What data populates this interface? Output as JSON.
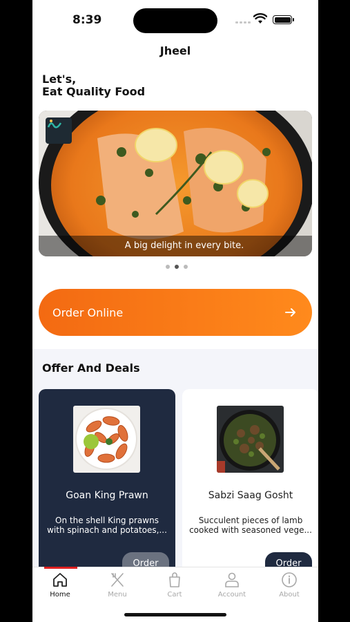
{
  "status_bar": {
    "time": "8:39"
  },
  "header": {
    "title": "Jheel"
  },
  "greeting": {
    "line1": "Let's,",
    "line2": "Eat Quality Food"
  },
  "banner": {
    "caption": "A big delight in every bite.",
    "logo_icon": "jheel-logo",
    "pages": 3,
    "active_page": 2
  },
  "order_online": {
    "label": "Order Online",
    "icon": "arrow-right-icon"
  },
  "offers": {
    "title": "Offer And Deals",
    "items": [
      {
        "name": "Goan King Prawn",
        "description_line1": "On the shell King prawns",
        "description_line2": "with spinach and potatoes,...",
        "button": "Order",
        "theme": "dark"
      },
      {
        "name": "Sabzi Saag Gosht",
        "description_line1": "Succulent pieces of lamb",
        "description_line2": "cooked with seasoned vege...",
        "button": "Order",
        "theme": "light"
      }
    ]
  },
  "tabbar": {
    "items": [
      {
        "label": "Home",
        "icon": "home-icon",
        "active": true
      },
      {
        "label": "Menu",
        "icon": "fork-knife-icon",
        "active": false
      },
      {
        "label": "Cart",
        "icon": "shopping-bag-icon",
        "active": false
      },
      {
        "label": "Account",
        "icon": "user-icon",
        "active": false
      },
      {
        "label": "About",
        "icon": "info-icon",
        "active": false
      }
    ]
  },
  "colors": {
    "accent_orange": "#f36a12",
    "card_dark": "#1f2a40",
    "tab_indicator": "#e02020"
  }
}
